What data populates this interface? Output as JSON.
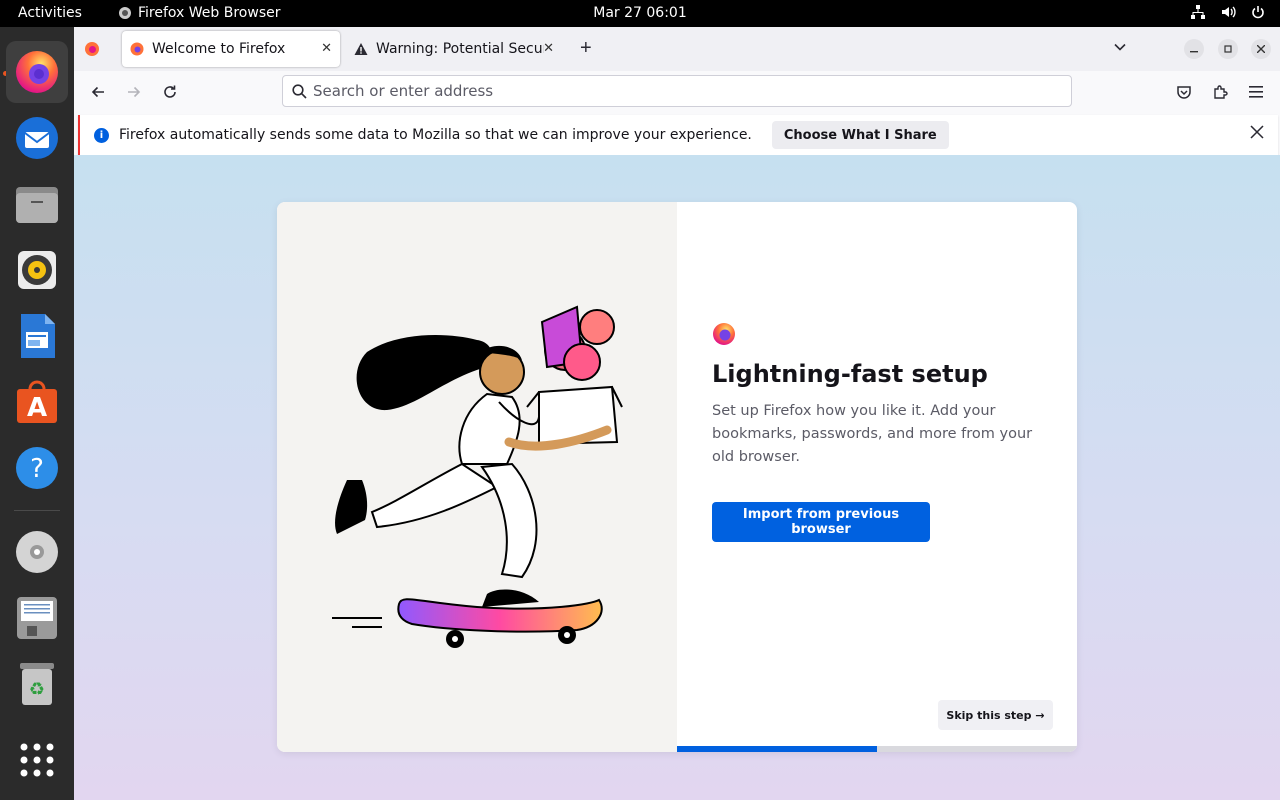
{
  "topbar": {
    "activities": "Activities",
    "app_name": "Firefox Web Browser",
    "clock": "Mar 27  06:01",
    "tray_icons": [
      "network-icon",
      "volume-icon",
      "power-icon"
    ]
  },
  "dock": {
    "items": [
      "firefox",
      "thunderbird",
      "files",
      "rhythmbox",
      "libreoffice-writer",
      "app-center",
      "help",
      "dvd",
      "floppy-save",
      "trash",
      "show-apps"
    ]
  },
  "tabs": [
    {
      "title": "Welcome to Firefox",
      "selected": true
    },
    {
      "title": "Warning: Potential Secur",
      "selected": false
    }
  ],
  "urlbar": {
    "placeholder": "Search or enter address"
  },
  "notification": {
    "message": "Firefox automatically sends some data to Mozilla so that we can improve your experience.",
    "button": "Choose What I Share"
  },
  "onboarding": {
    "title": "Lightning-fast setup",
    "subtitle": "Set up Firefox how you like it. Add your bookmarks, passwords, and more from your old browser.",
    "primary_button": "Import from previous browser",
    "skip_button": "Skip this step →",
    "progress": 0.5
  },
  "colors": {
    "accent": "#0061e0",
    "ubuntu_orange": "#e95420"
  }
}
